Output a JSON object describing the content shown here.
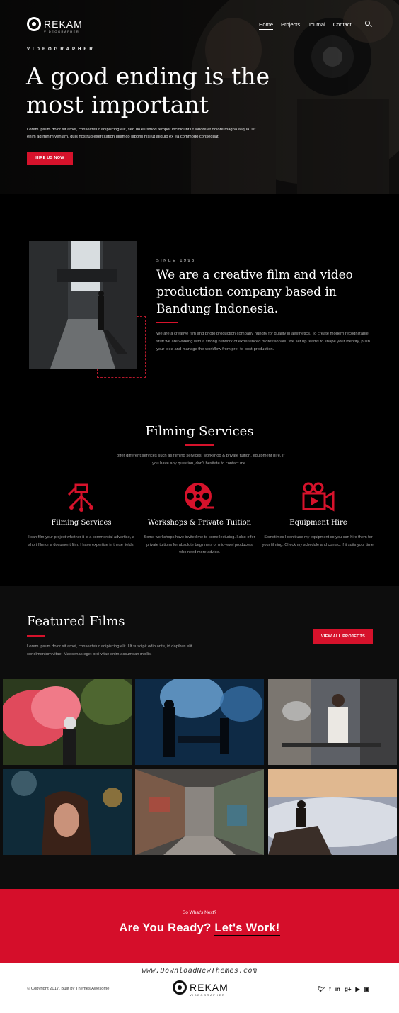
{
  "brand": {
    "name": "REKAM",
    "tagline": "VIDEOGRAPHER"
  },
  "nav": {
    "items": [
      "Home",
      "Projects",
      "Journal",
      "Contact"
    ],
    "active": "Home"
  },
  "hero": {
    "kicker": "VIDEOGRAPHER",
    "headline": "A good ending is the most important",
    "text": "Lorem ipsum dolor sit amet, consectetur adipiscing elit, sed do eiusmod tempor incididunt ut labore et dolore magna aliqua. Ut enim ad minim veniam, quis nostrud exercitation ullamco laboris nisi ut aliquip ex ea commodo consequat.",
    "button": "HIRE US NOW"
  },
  "about": {
    "since": "SINCE 1993",
    "title": "We are a creative film and video production company based in Bandung Indonesia.",
    "text": "We are a creative film and photo production company hungry for quality in aesthetics. To create modern recognizable stuff we are working with a strong network of experienced professionals. We set up teams to shape your identity, push your idea and manage the workflow from pre- to post-production."
  },
  "services": {
    "title": "Filming Services",
    "intro": "I offer different services such as filming services, workshop & private tuition, equipment hire. If you have any question, don't hesitate to contact me.",
    "items": [
      {
        "icon": "tripod-camera-icon",
        "title": "Filming Services",
        "text": "I can film your project whether it is a commercial advertise, a short film or a document film. I have expertise in these fields."
      },
      {
        "icon": "film-reel-icon",
        "title": "Workshops & Private Tuition",
        "text": "Some workshops have invited me to come lecturing. I also offer private tuitions for absolute beginners or mid-level producers who need more advice."
      },
      {
        "icon": "video-camera-icon",
        "title": "Equipment Hire",
        "text": "Sometimes I don't use my equipment so you can hire them for your filming. Check my schedule and contact if it suits your time."
      }
    ]
  },
  "featured": {
    "title": "Featured Films",
    "text": "Lorem ipsum dolor sit amet, consectetur adipiscing elit. Ut suscipit odio ante, id dapibus elit condimentum vitae. Maecenas eget orci vitae enim accumsan mollis.",
    "button": "VIEW ALL PROJECTS"
  },
  "cta": {
    "question": "So What's Next?",
    "lead": "Are You Ready?",
    "link": "Let's Work!"
  },
  "footer": {
    "watermark": "www.DownloadNewThemes.com",
    "copyright": "© Copyright 2017, Built by Themes Awesome",
    "socials": [
      "twitter-icon",
      "facebook-icon",
      "linkedin-icon",
      "google-plus-icon",
      "youtube-icon",
      "instagram-icon"
    ]
  },
  "colors": {
    "accent": "#d6122b",
    "background": "#000000",
    "footer": "#ffffff"
  }
}
